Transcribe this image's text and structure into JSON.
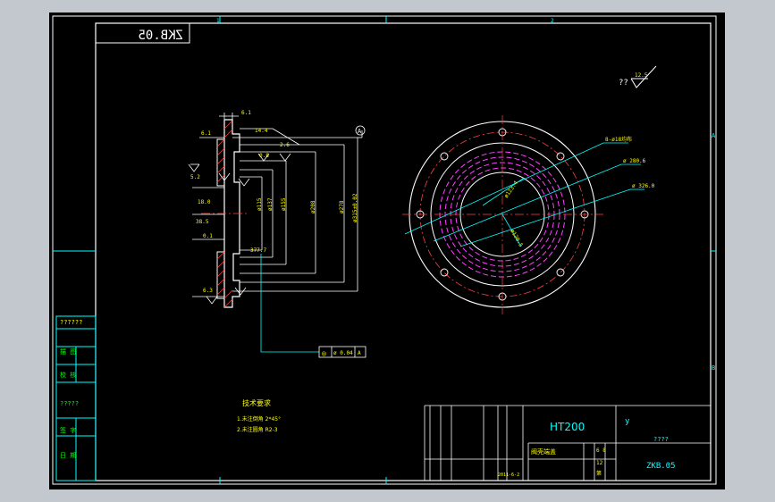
{
  "title_block": {
    "material": "HT200",
    "drawing_number": "ZKB.05",
    "drawing_number_mirrored": "ZKB.05",
    "part_name": "阀壳端盖",
    "company_placeholder": "????",
    "date": "2011-6-2",
    "sheet_total": "12",
    "sheet_label": "第",
    "y_label": "y",
    "scale_digits": "6 8"
  },
  "roughness": {
    "placeholder": "??",
    "value": "12.5"
  },
  "tech_requirements": {
    "heading": "技术要求",
    "items": [
      "1.未注倒角 2*45°",
      "2.未注圆角 R2-3"
    ]
  },
  "left_column": {
    "labels": [
      "??????",
      "描  图",
      "校  核",
      "?????",
      "签  字",
      "日  期"
    ]
  },
  "border": {
    "top_numbers": [
      "1",
      "2"
    ],
    "right_letters": [
      "A",
      "B"
    ]
  },
  "dimensions": {
    "d0": "6.1",
    "d1": "6.1",
    "d2": "14.4",
    "d3": "2.6",
    "d4": "0.8",
    "d5": "5.2",
    "d6": "18.0",
    "d7": "38.5",
    "d8": "0.1",
    "d9": "377.7",
    "d10": "6.3",
    "dia1": "ø115",
    "dia2": "ø137",
    "dia3": "ø155",
    "dia4": "ø208",
    "dia5": "ø278",
    "dia6": "ø315±0.02",
    "callout_circle": "8-ø18均布",
    "callout_a": "ø 280.6",
    "callout_b": "ø 326.0",
    "inner_a": "ø123.4",
    "inner_b": "ø120.5"
  },
  "tolerance_frame": {
    "symbol": "◎",
    "value": "ø 0.04",
    "datum": "A"
  },
  "datum_marker": "A"
}
